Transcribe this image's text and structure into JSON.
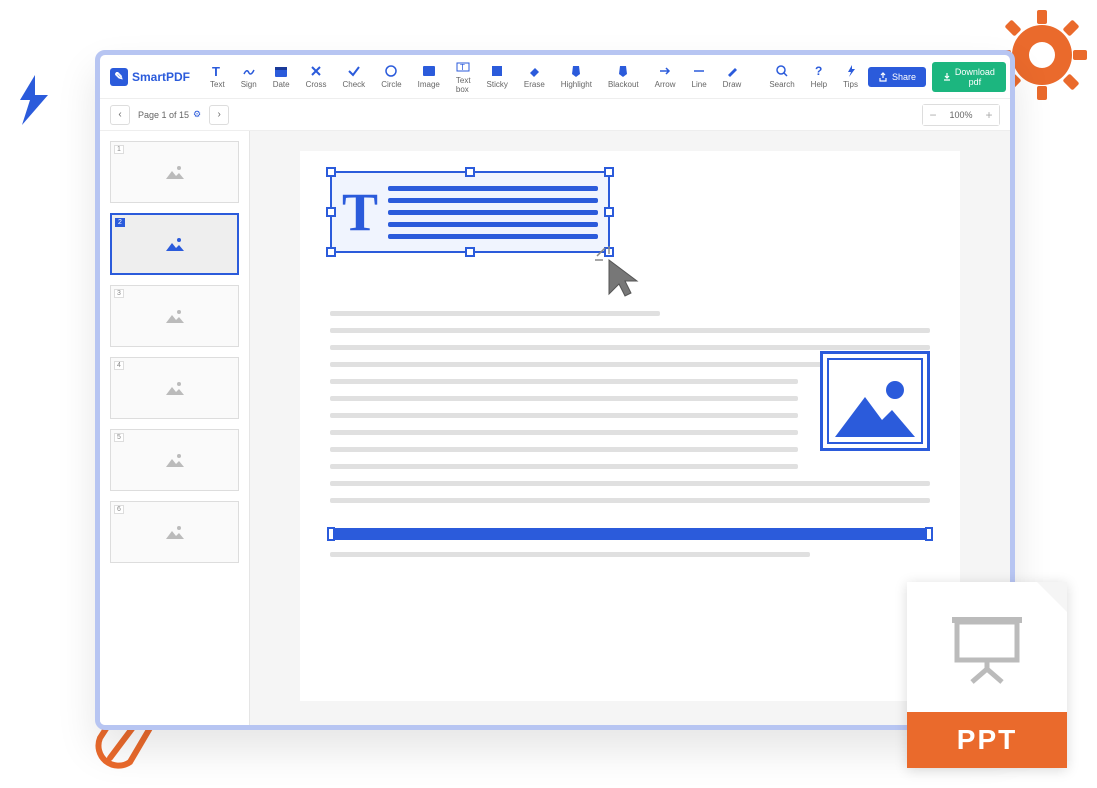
{
  "brand": "SmartPDF",
  "toolbar": [
    {
      "id": "text",
      "label": "Text"
    },
    {
      "id": "sign",
      "label": "Sign"
    },
    {
      "id": "date",
      "label": "Date"
    },
    {
      "id": "cross",
      "label": "Cross"
    },
    {
      "id": "check",
      "label": "Check"
    },
    {
      "id": "circle",
      "label": "Circle"
    },
    {
      "id": "image",
      "label": "Image"
    },
    {
      "id": "textbox",
      "label": "Text box"
    },
    {
      "id": "sticky",
      "label": "Sticky"
    },
    {
      "id": "erase",
      "label": "Erase"
    },
    {
      "id": "highlight",
      "label": "Highlight"
    },
    {
      "id": "blackout",
      "label": "Blackout"
    },
    {
      "id": "arrow",
      "label": "Arrow"
    },
    {
      "id": "line",
      "label": "Line"
    },
    {
      "id": "draw",
      "label": "Draw"
    }
  ],
  "utility": [
    {
      "id": "search",
      "label": "Search"
    },
    {
      "id": "help",
      "label": "Help"
    },
    {
      "id": "tips",
      "label": "Tips"
    }
  ],
  "share_label": "Share",
  "download_label": "Download pdf",
  "page_indicator": "Page 1 of 15",
  "zoom_value": "100%",
  "thumbnails": [
    1,
    2,
    3,
    4,
    5,
    6
  ],
  "active_thumb": 2,
  "ppt_label": "PPT",
  "text_glyph": "T"
}
